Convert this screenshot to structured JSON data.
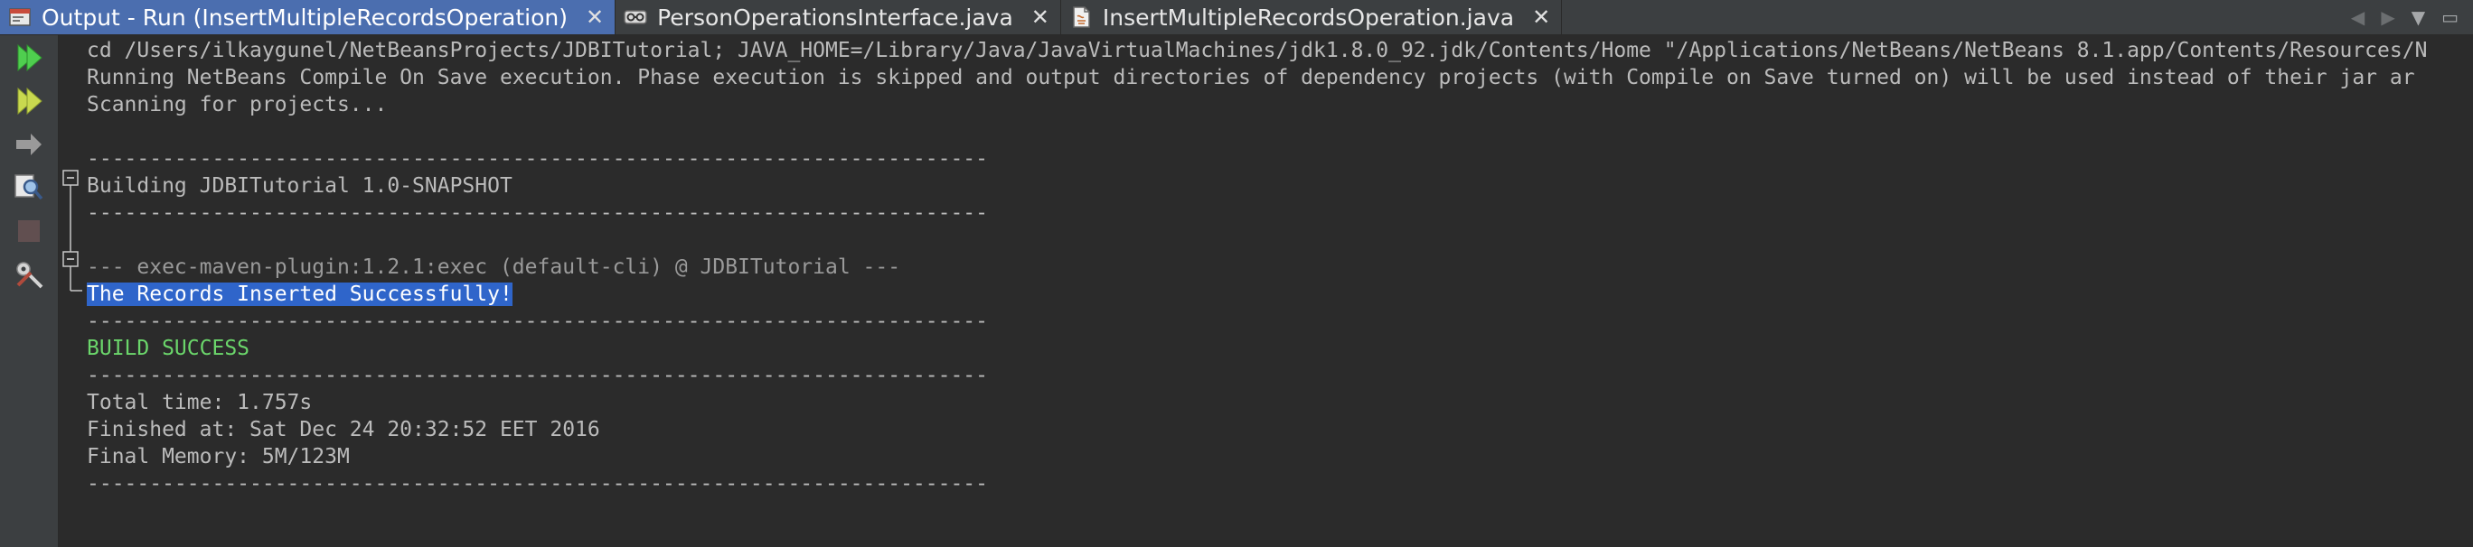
{
  "tabs": [
    {
      "label": "Output - Run (InsertMultipleRecordsOperation)",
      "icon": "output-window-icon",
      "active": true
    },
    {
      "label": "PersonOperationsInterface.java",
      "icon": "java-interface-icon",
      "active": false
    },
    {
      "label": "InsertMultipleRecordsOperation.java",
      "icon": "java-class-icon",
      "active": false
    }
  ],
  "tab_close_glyph": "✕",
  "toolbar": [
    {
      "name": "rerun-icon"
    },
    {
      "name": "rerun-with-options-icon"
    },
    {
      "name": "step-icon"
    },
    {
      "name": "inspect-icon"
    },
    {
      "name": "stop-icon"
    },
    {
      "name": "settings-icon"
    }
  ],
  "output": {
    "lines": [
      {
        "text": "cd /Users/ilkaygunel/NetBeansProjects/JDBITutorial; JAVA_HOME=/Library/Java/JavaVirtualMachines/jdk1.8.0_92.jdk/Contents/Home \"/Applications/NetBeans/NetBeans 8.1.app/Contents/Resources/N",
        "style": "normal"
      },
      {
        "text": "Running NetBeans Compile On Save execution. Phase execution is skipped and output directories of dependency projects (with Compile on Save turned on) will be used instead of their jar ar",
        "style": "normal"
      },
      {
        "text": "Scanning for projects...",
        "style": "normal"
      },
      {
        "text": "",
        "style": "normal"
      },
      {
        "text": "------------------------------------------------------------------------",
        "style": "sep"
      },
      {
        "text": "Building JDBITutorial 1.0-SNAPSHOT",
        "style": "normal"
      },
      {
        "text": "------------------------------------------------------------------------",
        "style": "sep"
      },
      {
        "text": "",
        "style": "normal"
      },
      {
        "text": "--- exec-maven-plugin:1.2.1:exec (default-cli) @ JDBITutorial ---",
        "style": "dim"
      },
      {
        "text": "The Records Inserted Successfully!",
        "style": "selected"
      },
      {
        "text": "------------------------------------------------------------------------",
        "style": "sep"
      },
      {
        "text": "BUILD SUCCESS",
        "style": "success"
      },
      {
        "text": "------------------------------------------------------------------------",
        "style": "sep"
      },
      {
        "text": "Total time: 1.757s",
        "style": "normal"
      },
      {
        "text": "Finished at: Sat Dec 24 20:32:52 EET 2016",
        "style": "normal"
      },
      {
        "text": "Final Memory: 5M/123M",
        "style": "normal"
      },
      {
        "text": "------------------------------------------------------------------------",
        "style": "sep"
      }
    ]
  },
  "colors": {
    "active_tab": "#4b6eaf",
    "selection": "#2f65ca",
    "success_text": "#6bd66b",
    "run_green": "#4fce4f"
  }
}
